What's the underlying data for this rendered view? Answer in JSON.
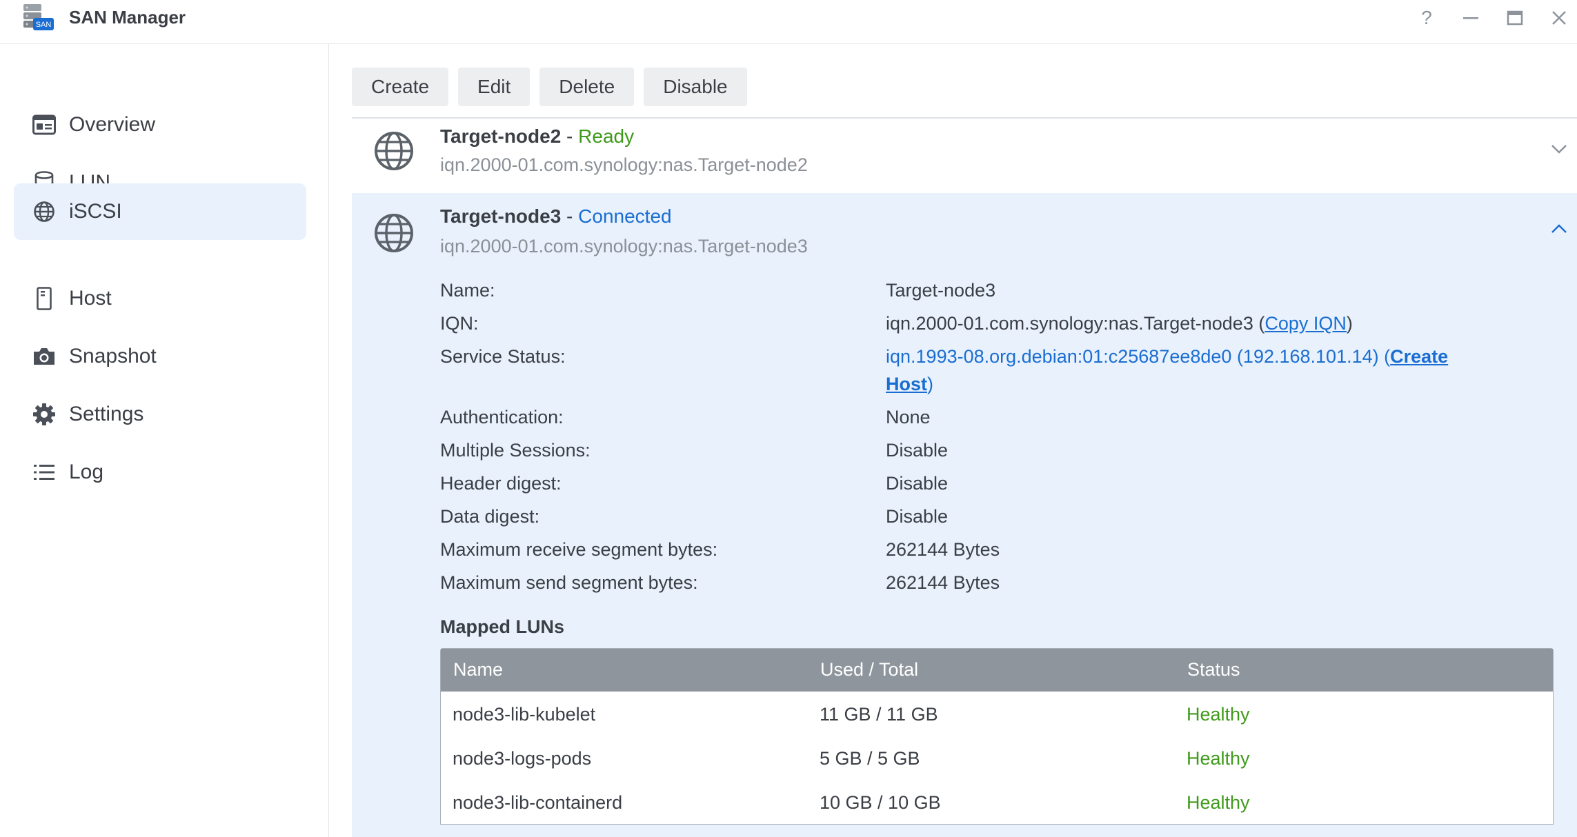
{
  "app": {
    "title": "SAN Manager",
    "icon": "san-storage-icon"
  },
  "window_controls": [
    {
      "name": "help",
      "glyph": "?"
    },
    {
      "name": "minimize",
      "glyph": "minimize"
    },
    {
      "name": "maximize",
      "glyph": "maximize"
    },
    {
      "name": "close",
      "glyph": "close"
    }
  ],
  "sidebar": {
    "items": [
      {
        "label": "Overview",
        "icon": "overview-icon",
        "active": false
      },
      {
        "label": "LUN",
        "icon": "database-icon",
        "active": false
      },
      {
        "label": "iSCSI",
        "icon": "globe-icon",
        "active": true
      },
      {
        "label": "Host",
        "icon": "host-icon",
        "active": false
      },
      {
        "label": "Snapshot",
        "icon": "camera-icon",
        "active": false
      },
      {
        "label": "Settings",
        "icon": "gear-icon",
        "active": false
      },
      {
        "label": "Log",
        "icon": "list-icon",
        "active": false
      }
    ]
  },
  "toolbar": {
    "create_label": "Create",
    "edit_label": "Edit",
    "delete_label": "Delete",
    "disable_label": "Disable"
  },
  "targets": [
    {
      "name": "Target-node2",
      "separator": " - ",
      "status": "Ready",
      "iqn": "iqn.2000-01.com.synology:nas.Target-node2",
      "expanded": false
    },
    {
      "name": "Target-node3",
      "separator": " - ",
      "status": "Connected",
      "iqn": "iqn.2000-01.com.synology:nas.Target-node3",
      "expanded": true,
      "details": {
        "name_label": "Name:",
        "name_value": "Target-node3",
        "iqn_label": "IQN:",
        "iqn_value": "iqn.2000-01.com.synology:nas.Target-node3",
        "copy_iqn_label": "Copy IQN",
        "service_status_label": "Service Status:",
        "service_status_value": "iqn.1993-08.org.debian:01:c25687ee8de0 (192.168.101.14)",
        "create_host_label_1": "Create",
        "create_host_label_2": "Host",
        "authentication_label": "Authentication:",
        "authentication_value": "None",
        "multiple_sessions_label": "Multiple Sessions:",
        "multiple_sessions_value": "Disable",
        "header_digest_label": "Header digest:",
        "header_digest_value": "Disable",
        "data_digest_label": "Data digest:",
        "data_digest_value": "Disable",
        "max_receive_label": "Maximum receive segment bytes:",
        "max_receive_value": "262144 Bytes",
        "max_send_label": "Maximum send segment bytes:",
        "max_send_value": "262144 Bytes"
      },
      "mapped_luns": {
        "title": "Mapped LUNs",
        "columns": [
          "Name",
          "Used / Total",
          "Status"
        ],
        "rows": [
          {
            "name": "node3-lib-kubelet",
            "used_total": "11 GB / 11 GB",
            "status": "Healthy"
          },
          {
            "name": "node3-logs-pods",
            "used_total": "5 GB / 5 GB",
            "status": "Healthy"
          },
          {
            "name": "node3-lib-containerd",
            "used_total": "10 GB / 10 GB",
            "status": "Healthy"
          }
        ]
      }
    }
  ],
  "colors": {
    "accent": "#1b6ed1",
    "ready": "#3f9a1b",
    "healthy": "#3f9a1b",
    "selected_bg": "#e8f1fc",
    "table_header": "#8e959c"
  }
}
